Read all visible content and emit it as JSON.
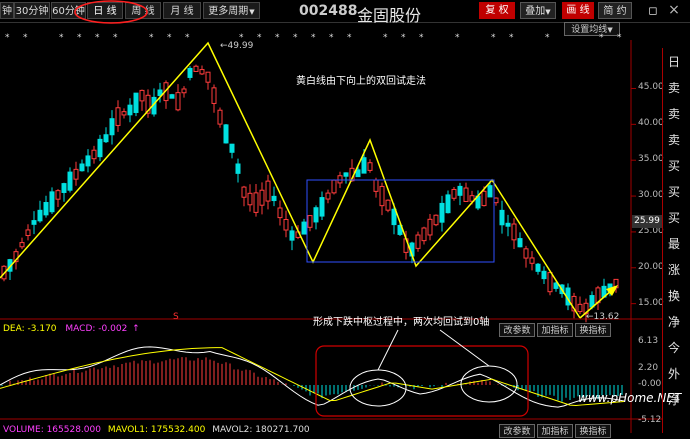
{
  "toolbar": {
    "min_label": "钟",
    "m30_label": "30分钟",
    "m60_label": "60分钟",
    "day_label": "日 线",
    "week_label": "周 线",
    "month_label": "月 线",
    "more_label": "更多周期",
    "more_arrow": "▼",
    "stock_code": "002488",
    "stock_name": "金固股份",
    "restore_label": "复 权",
    "overlay_label": "叠加",
    "overlay_arrow": "▼",
    "draw_label": "画 线",
    "review_label": "简 约",
    "close_glyph": "×",
    "maximize_glyph": "◻",
    "settings_label": "设置均线",
    "settings_arrow": "▼"
  },
  "price_axis": {
    "ticks": [
      "49.99",
      "45.00",
      "40.00",
      "35.00",
      "30.00",
      "25.00",
      "20.00",
      "15.00"
    ],
    "current": "25.99",
    "low": "13.62",
    "high": "49.99"
  },
  "annotations": {
    "top": "黄白线由下向上的双回试走法",
    "bottom": "形成下跌中枢过程中，两次均回试到0轴"
  },
  "macd": {
    "dea_label": "DEA: -3.170",
    "macd_label": "MACD: -0.002",
    "change_param": "改参数",
    "add_indicator": "加指标",
    "switch_indicator": "换指标",
    "ticks": [
      "6.13",
      "2.20",
      "-0.00",
      "-5.12"
    ]
  },
  "volume": {
    "volume_label": "VOLUME: 165528.000",
    "mavol1_label": "MAVOL1: 175532.400",
    "mavol2_label": "MAVOL2: 180271.700",
    "change_param": "改参数",
    "add_indicator": "加指标",
    "switch_indicator": "换指标"
  },
  "sidebar": {
    "items": [
      "日",
      "卖",
      "卖",
      "卖",
      "买",
      "买",
      "买",
      "最",
      "涨",
      "换",
      "净",
      "今",
      "外",
      "净"
    ]
  },
  "watermark": "www.pHome.NET",
  "colors": {
    "up": "#ff3c3c",
    "down": "#00e0e0",
    "trend": "#ffff00",
    "macd_white": "#ffffff",
    "macd_yellow": "#ffff00",
    "accent_red": "#c00000"
  }
}
